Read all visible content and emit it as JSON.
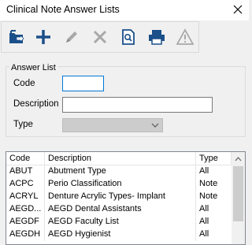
{
  "window": {
    "title": "Clinical Note Answer Lists",
    "close_icon": "close-icon"
  },
  "toolbar": {
    "buttons": [
      {
        "name": "open-folder",
        "icon": "folder-arrow-icon",
        "enabled": true
      },
      {
        "name": "add",
        "icon": "plus-icon",
        "enabled": true
      },
      {
        "name": "edit",
        "icon": "pencil-icon",
        "enabled": false
      },
      {
        "name": "delete",
        "icon": "x-icon",
        "enabled": false
      },
      {
        "name": "preview",
        "icon": "document-search-icon",
        "enabled": true
      },
      {
        "name": "print",
        "icon": "printer-icon",
        "enabled": true
      },
      {
        "name": "warning",
        "icon": "warning-triangle-icon",
        "enabled": false
      }
    ]
  },
  "answer_list": {
    "legend": "Answer List",
    "code_label": "Code",
    "code_value": "",
    "description_label": "Description",
    "description_value": "",
    "type_label": "Type",
    "type_value": ""
  },
  "table": {
    "columns": [
      "Code",
      "Description",
      "Type"
    ],
    "rows": [
      {
        "code": "ABUT",
        "description": "Abutment Type",
        "type": "All"
      },
      {
        "code": "ACPC",
        "description": "Perio Classification",
        "type": "Note"
      },
      {
        "code": "ACRYL",
        "description": "Denture Acrylic Types- Implant",
        "type": "Note"
      },
      {
        "code": "AEGD...",
        "description": "AEGD Dental Assistants",
        "type": "All"
      },
      {
        "code": "AEGDF",
        "description": "AEGD Faculty List",
        "type": "All"
      },
      {
        "code": "AEGDH",
        "description": "AEGD Hygienist",
        "type": "All"
      }
    ]
  },
  "colors": {
    "accent_blue": "#1b4f8a",
    "disabled_gray": "#9a9a9a",
    "focus_border": "#0078d7"
  }
}
